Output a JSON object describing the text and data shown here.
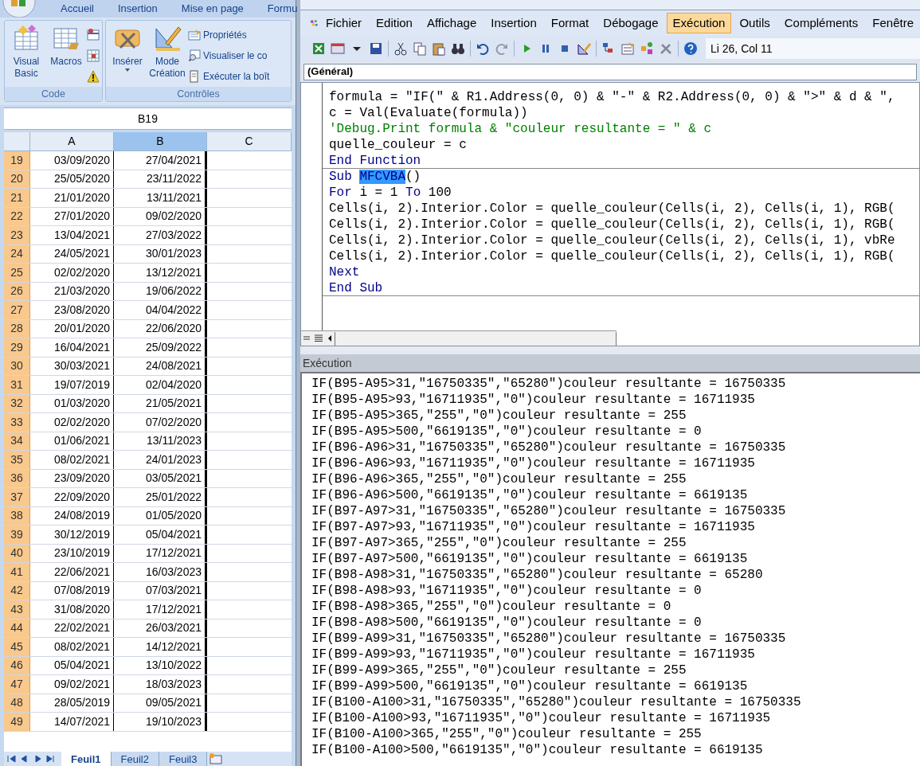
{
  "excel": {
    "ribbon_tabs": [
      {
        "label": "Accueil",
        "selected": false
      },
      {
        "label": "Insertion",
        "selected": false
      },
      {
        "label": "Mise en page",
        "selected": false
      },
      {
        "label": "Formu",
        "selected": false
      }
    ],
    "groups": [
      {
        "label": "Code",
        "large": [
          {
            "label": "Visual Basic",
            "dropdown": false
          },
          {
            "label": "Macros",
            "dropdown": false
          }
        ]
      },
      {
        "label": "Contrôles",
        "large": [
          {
            "label": "Insérer",
            "dropdown": true
          },
          {
            "label": "Mode Création",
            "dropdown": false
          }
        ],
        "small": [
          {
            "label": "Propriétés"
          },
          {
            "label": "Visualiser le co"
          },
          {
            "label": "Exécuter la boît"
          }
        ]
      }
    ],
    "name_box": "B19",
    "columns": [
      {
        "label": "A",
        "selected": false
      },
      {
        "label": "B",
        "selected": true
      },
      {
        "label": "C",
        "selected": false
      }
    ],
    "rows": [
      {
        "row": "19",
        "a": "03/09/2020",
        "b": "27/04/2021"
      },
      {
        "row": "20",
        "a": "25/05/2020",
        "b": "23/11/2022"
      },
      {
        "row": "21",
        "a": "21/01/2020",
        "b": "13/11/2021"
      },
      {
        "row": "22",
        "a": "27/01/2020",
        "b": "09/02/2020"
      },
      {
        "row": "23",
        "a": "13/04/2021",
        "b": "27/03/2022"
      },
      {
        "row": "24",
        "a": "24/05/2021",
        "b": "30/01/2023"
      },
      {
        "row": "25",
        "a": "02/02/2020",
        "b": "13/12/2021"
      },
      {
        "row": "26",
        "a": "21/03/2020",
        "b": "19/06/2022"
      },
      {
        "row": "27",
        "a": "23/08/2020",
        "b": "04/04/2022"
      },
      {
        "row": "28",
        "a": "20/01/2020",
        "b": "22/06/2020"
      },
      {
        "row": "29",
        "a": "16/04/2021",
        "b": "25/09/2022"
      },
      {
        "row": "30",
        "a": "30/03/2021",
        "b": "24/08/2021"
      },
      {
        "row": "31",
        "a": "19/07/2019",
        "b": "02/04/2020"
      },
      {
        "row": "32",
        "a": "01/03/2020",
        "b": "21/05/2021"
      },
      {
        "row": "33",
        "a": "02/02/2020",
        "b": "07/02/2020"
      },
      {
        "row": "34",
        "a": "01/06/2021",
        "b": "13/11/2023"
      },
      {
        "row": "35",
        "a": "08/02/2021",
        "b": "24/01/2023"
      },
      {
        "row": "36",
        "a": "23/09/2020",
        "b": "03/05/2021"
      },
      {
        "row": "37",
        "a": "22/09/2020",
        "b": "25/01/2022"
      },
      {
        "row": "38",
        "a": "24/08/2019",
        "b": "01/05/2020"
      },
      {
        "row": "39",
        "a": "30/12/2019",
        "b": "05/04/2021"
      },
      {
        "row": "40",
        "a": "23/10/2019",
        "b": "17/12/2021"
      },
      {
        "row": "41",
        "a": "22/06/2021",
        "b": "16/03/2023"
      },
      {
        "row": "42",
        "a": "07/08/2019",
        "b": "07/03/2021"
      },
      {
        "row": "43",
        "a": "31/08/2020",
        "b": "17/12/2021"
      },
      {
        "row": "44",
        "a": "22/02/2021",
        "b": "26/03/2021"
      },
      {
        "row": "45",
        "a": "08/02/2021",
        "b": "14/12/2021"
      },
      {
        "row": "46",
        "a": "05/04/2021",
        "b": "13/10/2022"
      },
      {
        "row": "47",
        "a": "09/02/2021",
        "b": "18/03/2023"
      },
      {
        "row": "48",
        "a": "28/05/2019",
        "b": "09/05/2021"
      },
      {
        "row": "49",
        "a": "14/07/2021",
        "b": "19/10/2023"
      }
    ],
    "sheet_tabs": [
      {
        "label": "Feuil1",
        "selected": true
      },
      {
        "label": "Feuil2",
        "selected": false
      },
      {
        "label": "Feuil3",
        "selected": false
      }
    ]
  },
  "vbe": {
    "menu": [
      {
        "label": "Fichier",
        "selected": false
      },
      {
        "label": "Edition",
        "selected": false
      },
      {
        "label": "Affichage",
        "selected": false
      },
      {
        "label": "Insertion",
        "selected": false
      },
      {
        "label": "Format",
        "selected": false
      },
      {
        "label": "Débogage",
        "selected": false
      },
      {
        "label": "Exécution",
        "selected": true
      },
      {
        "label": "Outils",
        "selected": false
      },
      {
        "label": "Compléments",
        "selected": false
      },
      {
        "label": "Fenêtre",
        "selected": false
      }
    ],
    "position": "Li 26, Col 11",
    "object_dropdown": "(Général)",
    "code_lines": [
      {
        "separator": false,
        "parts": [
          {
            "kind": "plain",
            "text": "formula = \"IF(\" & R1.Address(0, 0) & \"-\" & R2.Address(0, 0) & \">\" & d & \","
          }
        ]
      },
      {
        "separator": false,
        "parts": [
          {
            "kind": "plain",
            "text": "c = Val(Evaluate(formula))"
          }
        ]
      },
      {
        "separator": false,
        "parts": [
          {
            "kind": "comment",
            "text": "'Debug.Print formula & \"couleur resultante = \" & c"
          }
        ]
      },
      {
        "separator": false,
        "parts": [
          {
            "kind": "plain",
            "text": "quelle_couleur = c"
          }
        ]
      },
      {
        "separator": true,
        "parts": [
          {
            "kind": "keyword",
            "text": "End Function"
          }
        ]
      },
      {
        "separator": false,
        "parts": [
          {
            "kind": "keyword",
            "text": "Sub "
          },
          {
            "kind": "selected",
            "text": "MFCVBA"
          },
          {
            "kind": "plain",
            "text": "()"
          }
        ]
      },
      {
        "separator": false,
        "parts": [
          {
            "kind": "keyword",
            "text": "For"
          },
          {
            "kind": "plain",
            "text": " i = 1 "
          },
          {
            "kind": "keyword",
            "text": "To"
          },
          {
            "kind": "plain",
            "text": " 100"
          }
        ]
      },
      {
        "separator": false,
        "parts": [
          {
            "kind": "plain",
            "text": "Cells(i, 2).Interior.Color = quelle_couleur(Cells(i, 2), Cells(i, 1), RGB("
          }
        ]
      },
      {
        "separator": false,
        "parts": [
          {
            "kind": "plain",
            "text": "Cells(i, 2).Interior.Color = quelle_couleur(Cells(i, 2), Cells(i, 1), RGB("
          }
        ]
      },
      {
        "separator": false,
        "parts": [
          {
            "kind": "plain",
            "text": "Cells(i, 2).Interior.Color = quelle_couleur(Cells(i, 2), Cells(i, 1), vbRe"
          }
        ]
      },
      {
        "separator": false,
        "parts": [
          {
            "kind": "plain",
            "text": "Cells(i, 2).Interior.Color = quelle_couleur(Cells(i, 2), Cells(i, 1), RGB("
          }
        ]
      },
      {
        "separator": false,
        "parts": [
          {
            "kind": "keyword",
            "text": "Next"
          }
        ]
      },
      {
        "separator": true,
        "parts": [
          {
            "kind": "keyword",
            "text": "End Sub"
          }
        ]
      }
    ],
    "immediate_title": "Exécution",
    "immediate_lines": [
      "IF(B95-A95>31,\"16750335\",\"65280\")couleur resultante = 16750335",
      "IF(B95-A95>93,\"16711935\",\"0\")couleur resultante = 16711935",
      "IF(B95-A95>365,\"255\",\"0\")couleur resultante = 255",
      "IF(B95-A95>500,\"6619135\",\"0\")couleur resultante = 0",
      "IF(B96-A96>31,\"16750335\",\"65280\")couleur resultante = 16750335",
      "IF(B96-A96>93,\"16711935\",\"0\")couleur resultante = 16711935",
      "IF(B96-A96>365,\"255\",\"0\")couleur resultante = 255",
      "IF(B96-A96>500,\"6619135\",\"0\")couleur resultante = 6619135",
      "IF(B97-A97>31,\"16750335\",\"65280\")couleur resultante = 16750335",
      "IF(B97-A97>93,\"16711935\",\"0\")couleur resultante = 16711935",
      "IF(B97-A97>365,\"255\",\"0\")couleur resultante = 255",
      "IF(B97-A97>500,\"6619135\",\"0\")couleur resultante = 6619135",
      "IF(B98-A98>31,\"16750335\",\"65280\")couleur resultante = 65280",
      "IF(B98-A98>93,\"16711935\",\"0\")couleur resultante = 0",
      "IF(B98-A98>365,\"255\",\"0\")couleur resultante = 0",
      "IF(B98-A98>500,\"6619135\",\"0\")couleur resultante = 0",
      "IF(B99-A99>31,\"16750335\",\"65280\")couleur resultante = 16750335",
      "IF(B99-A99>93,\"16711935\",\"0\")couleur resultante = 16711935",
      "IF(B99-A99>365,\"255\",\"0\")couleur resultante = 255",
      "IF(B99-A99>500,\"6619135\",\"0\")couleur resultante = 6619135",
      "IF(B100-A100>31,\"16750335\",\"65280\")couleur resultante = 16750335",
      "IF(B100-A100>93,\"16711935\",\"0\")couleur resultante = 16711935",
      "IF(B100-A100>365,\"255\",\"0\")couleur resultante = 255",
      "IF(B100-A100>500,\"6619135\",\"0\")couleur resultante = 6619135"
    ]
  }
}
